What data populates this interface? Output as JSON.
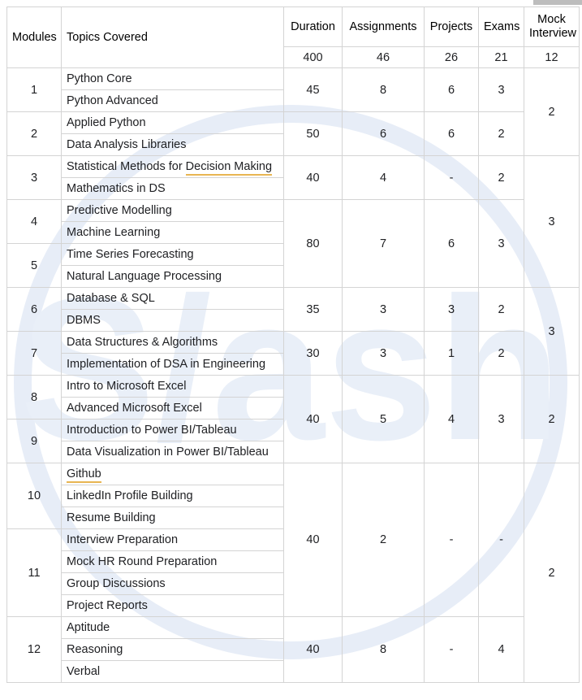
{
  "table": {
    "headers": {
      "modules": "Modules",
      "topics": "Topics Covered",
      "duration": "Duration",
      "assignments": "Assignments",
      "projects": "Projects",
      "exams": "Exams",
      "mock_interview": "Mock Interview"
    },
    "totals": {
      "duration": "400",
      "assignments": "46",
      "projects": "26",
      "exams": "21",
      "mock_interview": "12"
    },
    "modules": [
      {
        "number": "1",
        "topics": [
          "Python Core",
          "Python Advanced"
        ]
      },
      {
        "number": "2",
        "topics": [
          "Applied Python",
          "Data Analysis Libraries"
        ]
      },
      {
        "number": "3",
        "topics": [
          "Statistical Methods for Decision Making",
          "Mathematics in DS"
        ]
      },
      {
        "number": "4",
        "topics": [
          "Predictive Modelling",
          "Machine Learning"
        ]
      },
      {
        "number": "5",
        "topics": [
          "Time Series Forecasting",
          "Natural Language Processing"
        ]
      },
      {
        "number": "6",
        "topics": [
          "Database & SQL",
          "DBMS"
        ]
      },
      {
        "number": "7",
        "topics": [
          "Data Structures & Algorithms",
          "Implementation of DSA in Engineering"
        ]
      },
      {
        "number": "8",
        "topics": [
          "Intro to Microsoft Excel",
          "Advanced Microsoft Excel"
        ]
      },
      {
        "number": "9",
        "topics": [
          "Introduction to Power BI/Tableau",
          "Data Visualization in Power BI/Tableau"
        ]
      },
      {
        "number": "10",
        "topics": [
          "Github",
          "LinkedIn Profile Building",
          "Resume Building"
        ]
      },
      {
        "number": "11",
        "topics": [
          "Interview Preparation",
          "Mock HR Round Preparation",
          "Group Discussions",
          "Project Reports"
        ]
      },
      {
        "number": "12",
        "topics": [
          "Aptitude",
          "Reasoning",
          "Verbal"
        ]
      }
    ],
    "metric_groups": [
      {
        "modules": [
          "1"
        ],
        "duration": "45",
        "assignments": "8",
        "projects": "6",
        "exams": "3"
      },
      {
        "modules": [
          "2"
        ],
        "duration": "50",
        "assignments": "6",
        "projects": "6",
        "exams": "2"
      },
      {
        "modules": [
          "3"
        ],
        "duration": "40",
        "assignments": "4",
        "projects": "-",
        "exams": "2"
      },
      {
        "modules": [
          "4",
          "5"
        ],
        "duration": "80",
        "assignments": "7",
        "projects": "6",
        "exams": "3"
      },
      {
        "modules": [
          "6"
        ],
        "duration": "35",
        "assignments": "3",
        "projects": "3",
        "exams": "2"
      },
      {
        "modules": [
          "7"
        ],
        "duration": "30",
        "assignments": "3",
        "projects": "1",
        "exams": "2"
      },
      {
        "modules": [
          "8",
          "9"
        ],
        "duration": "40",
        "assignments": "5",
        "projects": "4",
        "exams": "3"
      },
      {
        "modules": [
          "10",
          "11"
        ],
        "duration": "40",
        "assignments": "2",
        "projects": "-",
        "exams": "-"
      },
      {
        "modules": [
          "12"
        ],
        "duration": "40",
        "assignments": "8",
        "projects": "-",
        "exams": "4"
      }
    ],
    "mock_interview_groups": [
      {
        "modules": [
          "1",
          "2"
        ],
        "value": "2"
      },
      {
        "modules": [
          "3",
          "4",
          "5"
        ],
        "value": "3"
      },
      {
        "modules": [
          "6",
          "7"
        ],
        "value": "3"
      },
      {
        "modules": [
          "8",
          "9"
        ],
        "value": "2"
      },
      {
        "modules": [
          "10",
          "11",
          "12"
        ],
        "value": "2"
      }
    ],
    "spellchecked_terms": [
      "Decision Making",
      "Github"
    ]
  },
  "watermark": {
    "text": "S/ash",
    "color": "#e5ecf6"
  },
  "colors": {
    "grid_line": "#d4d4d4",
    "text": "#202124",
    "spellcheck_underline": "#e8b552"
  }
}
